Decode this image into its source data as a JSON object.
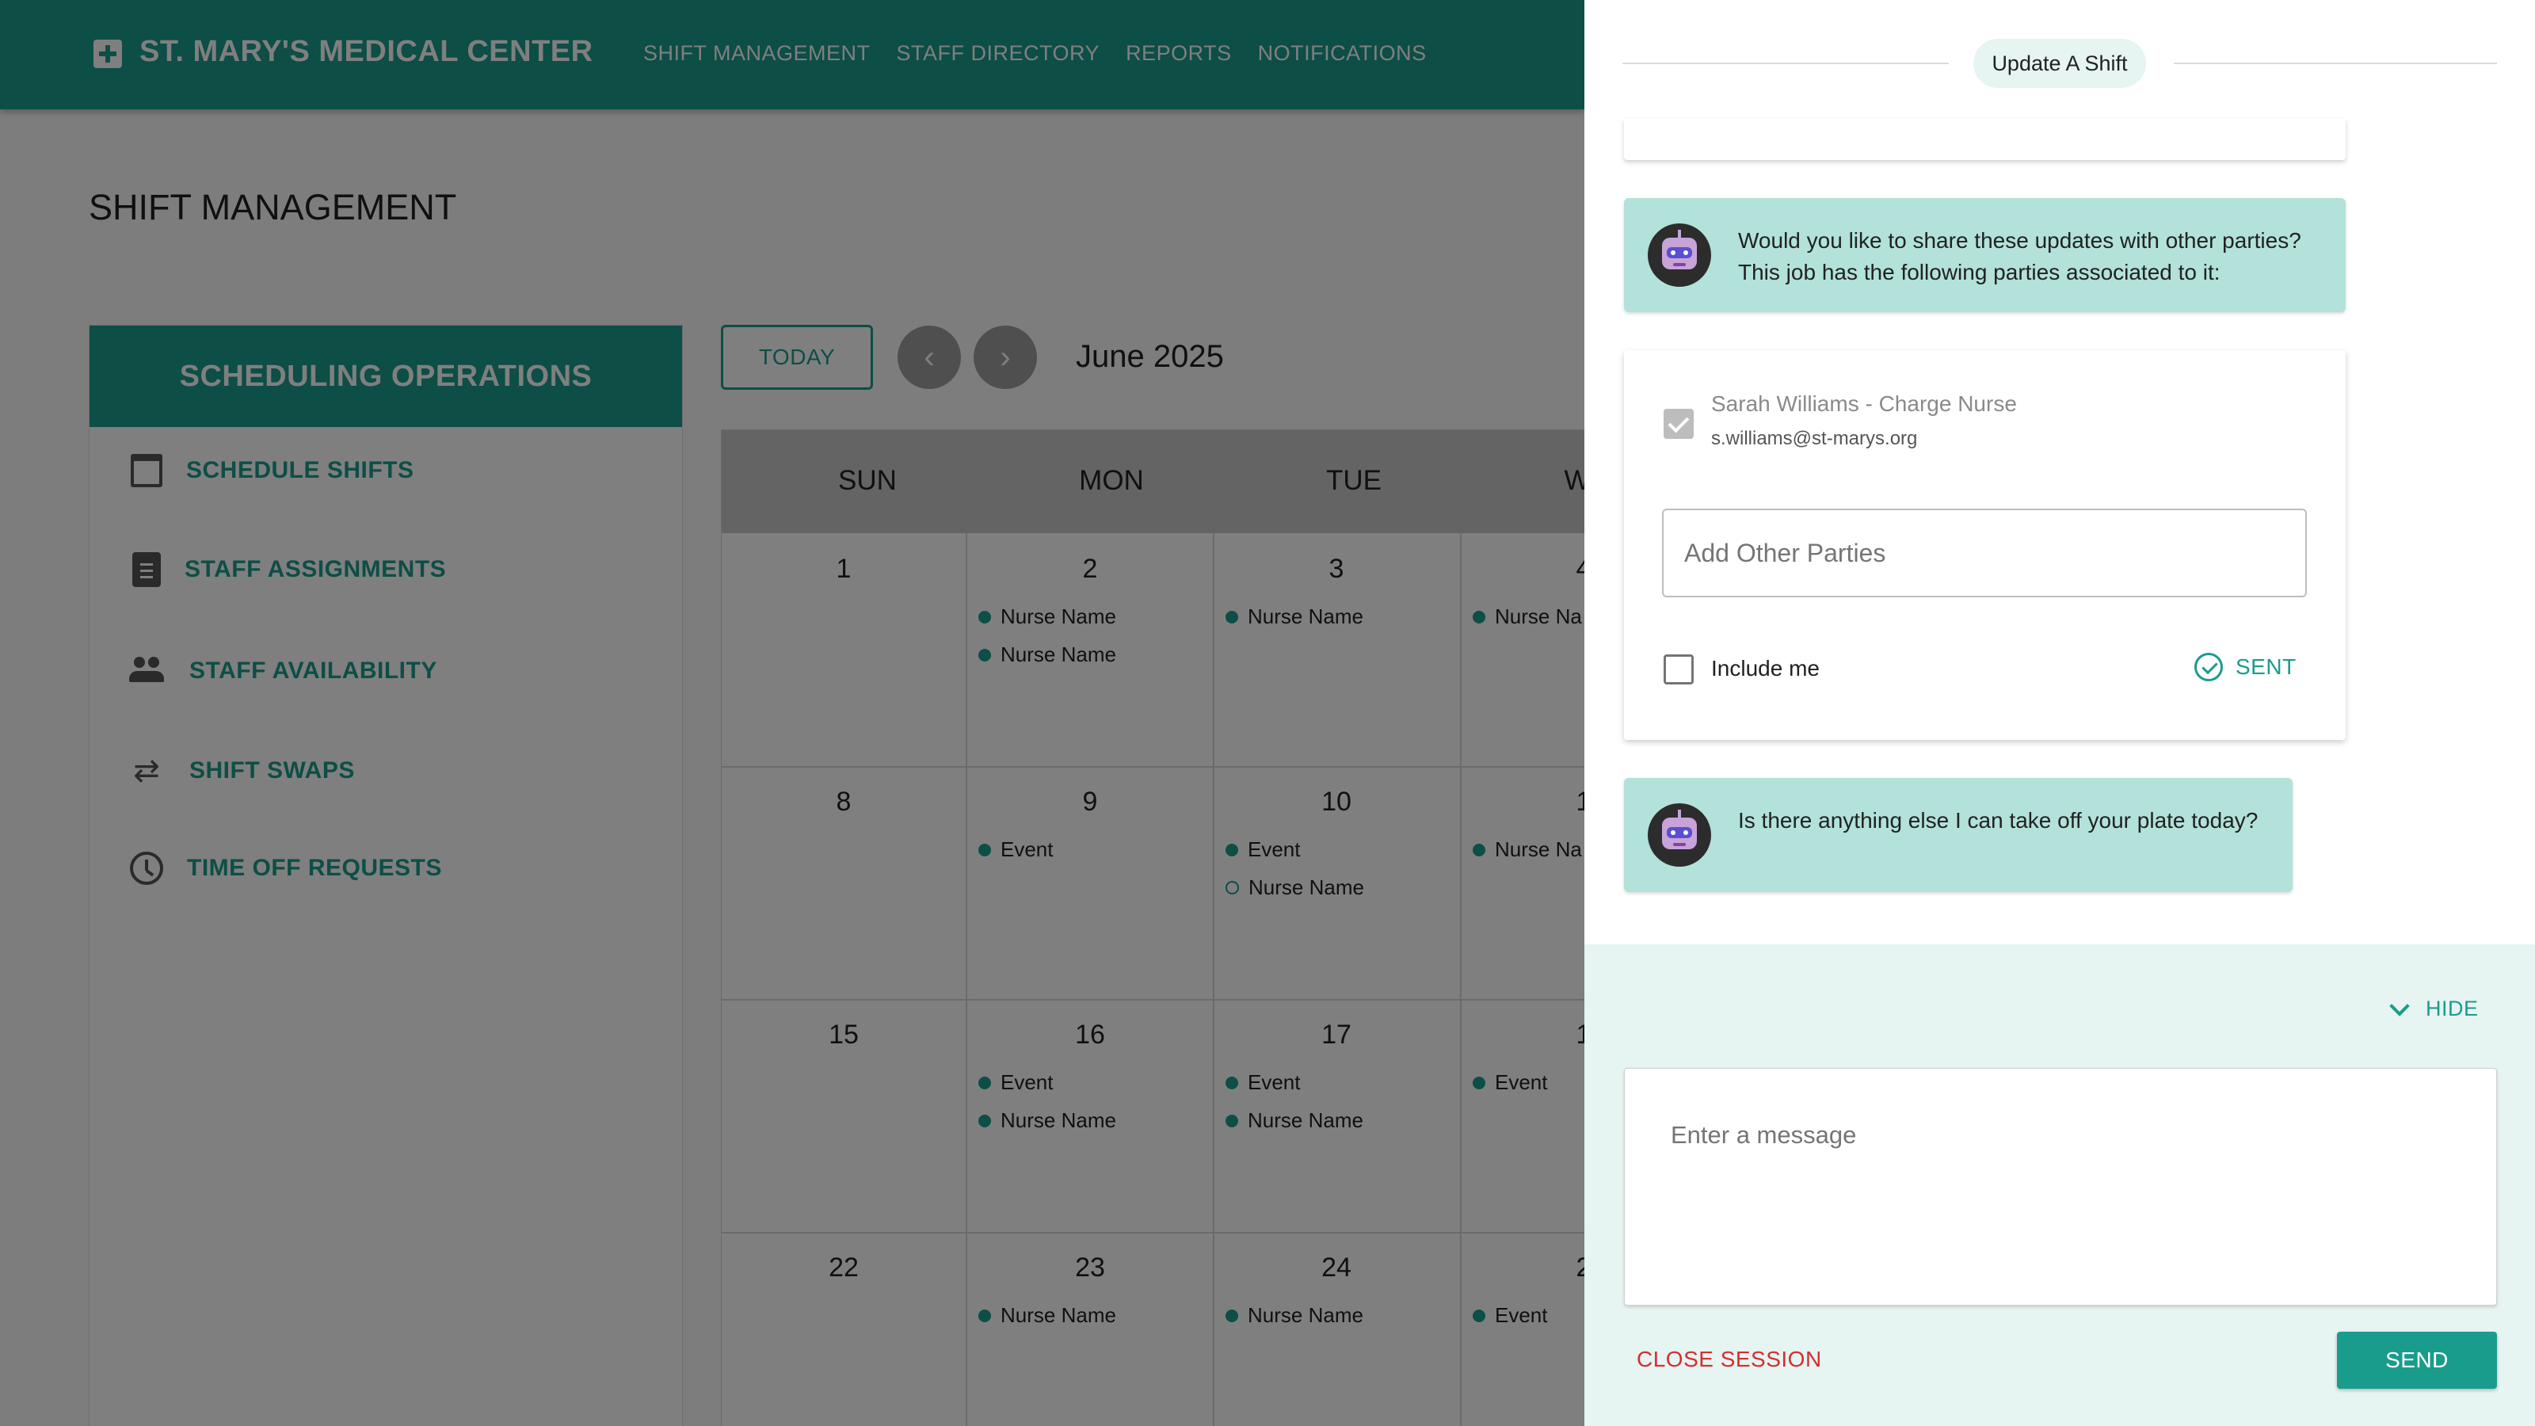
{
  "header": {
    "brand": "ST. MARY'S MEDICAL CENTER",
    "nav": [
      "SHIFT MANAGEMENT",
      "STAFF DIRECTORY",
      "REPORTS",
      "NOTIFICATIONS"
    ]
  },
  "page": {
    "title": "SHIFT MANAGEMENT"
  },
  "sidebar": {
    "title": "SCHEDULING OPERATIONS",
    "items": [
      {
        "label": "SCHEDULE SHIFTS",
        "icon": "calendar-icon"
      },
      {
        "label": "STAFF ASSIGNMENTS",
        "icon": "clipboard-icon"
      },
      {
        "label": "STAFF AVAILABILITY",
        "icon": "people-icon"
      },
      {
        "label": "SHIFT SWAPS",
        "icon": "swap-icon"
      },
      {
        "label": "TIME OFF REQUESTS",
        "icon": "clock-icon"
      }
    ]
  },
  "calendar": {
    "today_label": "TODAY",
    "prev_icon": "chevron-left-icon",
    "next_icon": "chevron-right-icon",
    "month": "June 2025",
    "weekdays": [
      "SUN",
      "MON",
      "TUE",
      "W"
    ],
    "weeks": [
      {
        "days": [
          {
            "num": "1",
            "events": []
          },
          {
            "num": "2",
            "events": [
              "Nurse Name",
              "Nurse Name"
            ]
          },
          {
            "num": "3",
            "events": [
              "Nurse Name"
            ]
          },
          {
            "num": "4",
            "events": [
              "Nurse Na"
            ]
          }
        ]
      },
      {
        "days": [
          {
            "num": "8",
            "events": []
          },
          {
            "num": "9",
            "events": [
              "Event"
            ]
          },
          {
            "num": "10",
            "events": [
              "Event",
              "Nurse Name"
            ]
          },
          {
            "num": "1",
            "events": [
              "Nurse Na"
            ]
          }
        ]
      },
      {
        "days": [
          {
            "num": "15",
            "events": []
          },
          {
            "num": "16",
            "events": [
              "Event",
              "Nurse Name"
            ]
          },
          {
            "num": "17",
            "events": [
              "Event",
              "Nurse Name"
            ]
          },
          {
            "num": "1",
            "events": [
              "Event"
            ]
          }
        ]
      },
      {
        "days": [
          {
            "num": "22",
            "events": []
          },
          {
            "num": "23",
            "events": [
              "Nurse Name"
            ]
          },
          {
            "num": "24",
            "events": [
              "Nurse Name"
            ]
          },
          {
            "num": "2",
            "events": [
              "Event"
            ]
          }
        ]
      }
    ]
  },
  "chat": {
    "chip": "Update A Shift",
    "bot_icon": "robot-avatar-icon",
    "message1": [
      "Would you like to share these updates with other parties?",
      "This job has the following parties associated to it:"
    ],
    "party": {
      "name": "Sarah Williams - Charge Nurse",
      "email": "s.williams@st-marys.org"
    },
    "add_parties_placeholder": "Add Other Parties",
    "include_me": "Include me",
    "sent_label": "SENT",
    "message2": "Is there anything else I can take off your plate today?",
    "hide_label": "HIDE",
    "message_placeholder": "Enter a message",
    "close_session": "CLOSE SESSION",
    "send": "SEND"
  },
  "colors": {
    "brand": "#1a9c8c",
    "bubble": "#b2e2da",
    "composer_bg": "#e6f4f2",
    "danger": "#d32f2f"
  }
}
